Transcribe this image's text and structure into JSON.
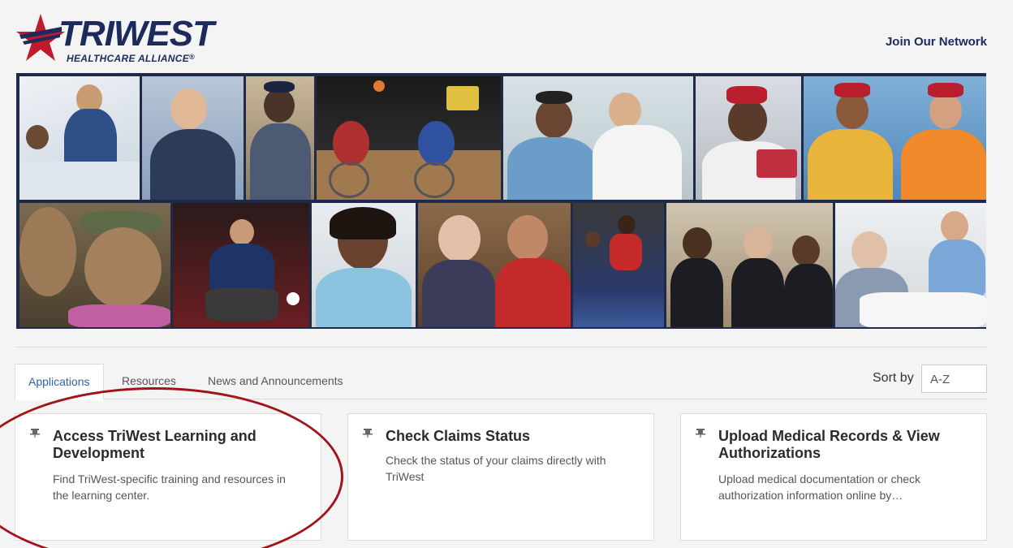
{
  "brand": {
    "name": "TRIWEST",
    "tagline": "HEALTHCARE ALLIANCE",
    "registered": "®",
    "star_color": "#c01b2c",
    "navy": "#1d2a5c"
  },
  "header": {
    "join_link": "Join Our Network"
  },
  "tabs": [
    {
      "label": "Applications",
      "active": true
    },
    {
      "label": "Resources",
      "active": false
    },
    {
      "label": "News and Announcements",
      "active": false
    }
  ],
  "sort": {
    "label": "Sort by",
    "value": "A-Z"
  },
  "cards": [
    {
      "title": "Access TriWest Learning and Development",
      "description": "Find TriWest-specific training and resources in the learning center.",
      "icon": "pin-icon"
    },
    {
      "title": "Check Claims Status",
      "description": "Check the status of your claims directly with TriWest",
      "icon": "pin-icon"
    },
    {
      "title": "Upload Medical Records & View Authorizations",
      "description": "Upload medical documentation or check authorization information online by…",
      "icon": "pin-icon"
    }
  ],
  "annotation": {
    "circle_color": "#a2141a"
  },
  "mosaic_icon": "photo-collage-image"
}
